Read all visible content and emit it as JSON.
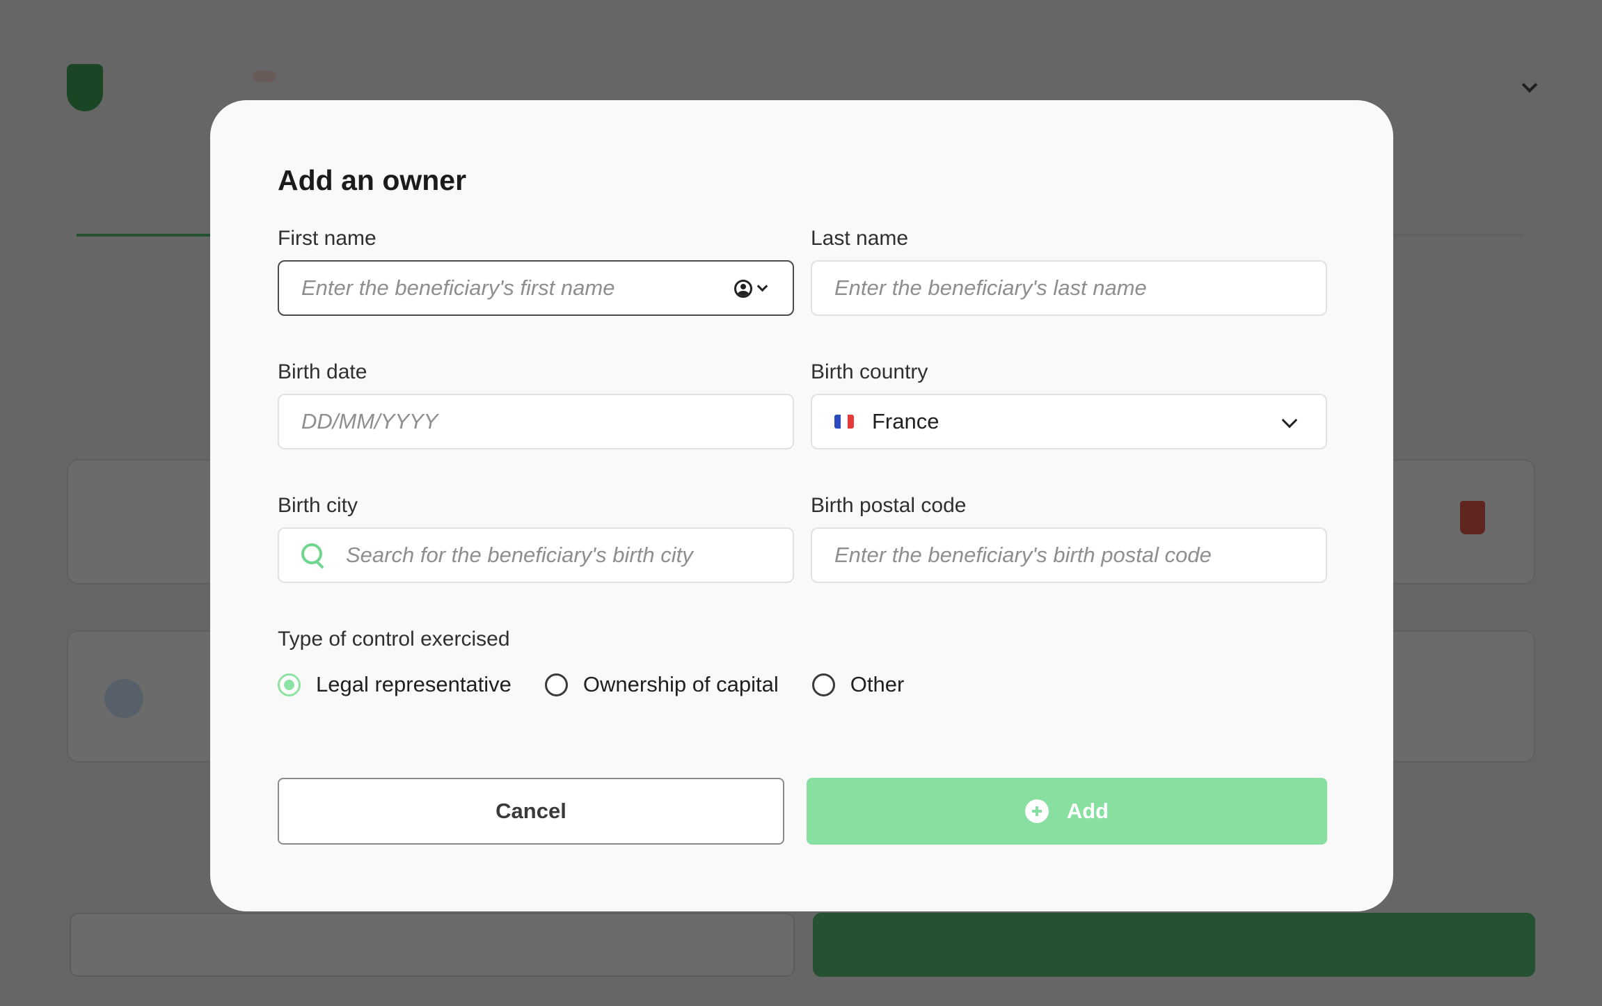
{
  "modal": {
    "title": "Add an owner",
    "fields": {
      "first_name": {
        "label": "First name",
        "placeholder": "Enter the beneficiary's first name"
      },
      "last_name": {
        "label": "Last name",
        "placeholder": "Enter the beneficiary's last name"
      },
      "birth_date": {
        "label": "Birth date",
        "placeholder": "DD/MM/YYYY"
      },
      "birth_country": {
        "label": "Birth country",
        "value": "France"
      },
      "birth_city": {
        "label": "Birth city",
        "placeholder": "Search for the beneficiary's birth city"
      },
      "birth_postal_code": {
        "label": "Birth postal code",
        "placeholder": "Enter the beneficiary's birth postal code"
      }
    },
    "control": {
      "label": "Type of control exercised",
      "options": [
        "Legal representative",
        "Ownership of capital",
        "Other"
      ],
      "selected": "Legal representative"
    },
    "buttons": {
      "cancel": "Cancel",
      "add": "Add"
    }
  },
  "icons": {
    "first_name_contact": "person-circle-icon",
    "first_name_chevron": "chevron-down-icon",
    "country_flag": "france-flag-icon",
    "country_chevron": "chevron-down-icon",
    "city_search": "search-icon",
    "add": "plus-circle-icon"
  },
  "colors": {
    "accent_green": "#88e0a0",
    "search_icon_green": "#6fd68f",
    "modal_background": "#f9f9f9",
    "overlay": "#6b6b6b"
  }
}
